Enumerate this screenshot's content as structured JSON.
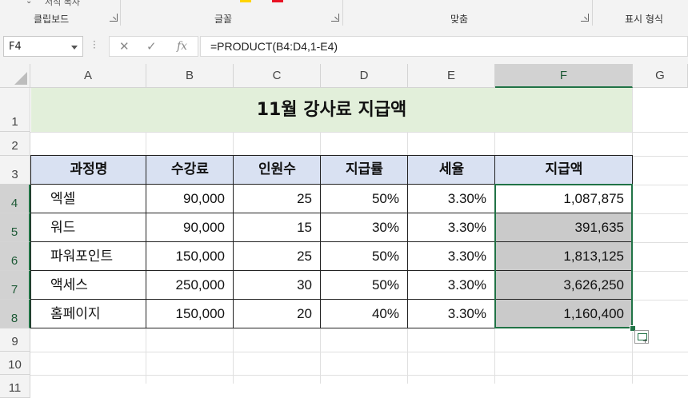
{
  "ribbon": {
    "clipboard_hint": "서식 복사",
    "groups": [
      {
        "label": "클립보드"
      },
      {
        "label": "글꼴"
      },
      {
        "label": "맞춤"
      },
      {
        "label": "표시 형식"
      }
    ],
    "font_color_swatches": [
      "#ffd400",
      "#e81123"
    ]
  },
  "formula_bar": {
    "name_box": "F4",
    "formula": "=PRODUCT(B4:D4,1-E4)",
    "cancel_icon": "x-icon",
    "enter_icon": "check-icon",
    "function_icon": "fx-icon"
  },
  "columns": [
    "A",
    "B",
    "C",
    "D",
    "E",
    "F",
    "G"
  ],
  "rows": [
    "1",
    "2",
    "3",
    "4",
    "5",
    "6",
    "7",
    "8",
    "9",
    "10",
    "11"
  ],
  "sheet": {
    "title": "11월 강사료 지급액",
    "headers": [
      "과정명",
      "수강료",
      "인원수",
      "지급률",
      "세율",
      "지급액"
    ],
    "data": [
      [
        "엑셀",
        "90,000",
        "25",
        "50%",
        "3.30%",
        "1,087,875"
      ],
      [
        "워드",
        "90,000",
        "15",
        "30%",
        "3.30%",
        "391,635"
      ],
      [
        "파워포인트",
        "150,000",
        "25",
        "50%",
        "3.30%",
        "1,813,125"
      ],
      [
        "액세스",
        "250,000",
        "30",
        "50%",
        "3.30%",
        "3,626,250"
      ],
      [
        "홈페이지",
        "150,000",
        "20",
        "40%",
        "3.30%",
        "1,160,400"
      ]
    ]
  },
  "colors": {
    "title_fill": "#e2efda",
    "header_fill": "#d9e1f2",
    "selection_fill": "#cacaca",
    "accent": "#217346"
  },
  "selection": {
    "active_cell": "F4",
    "range": "F4:F8"
  }
}
